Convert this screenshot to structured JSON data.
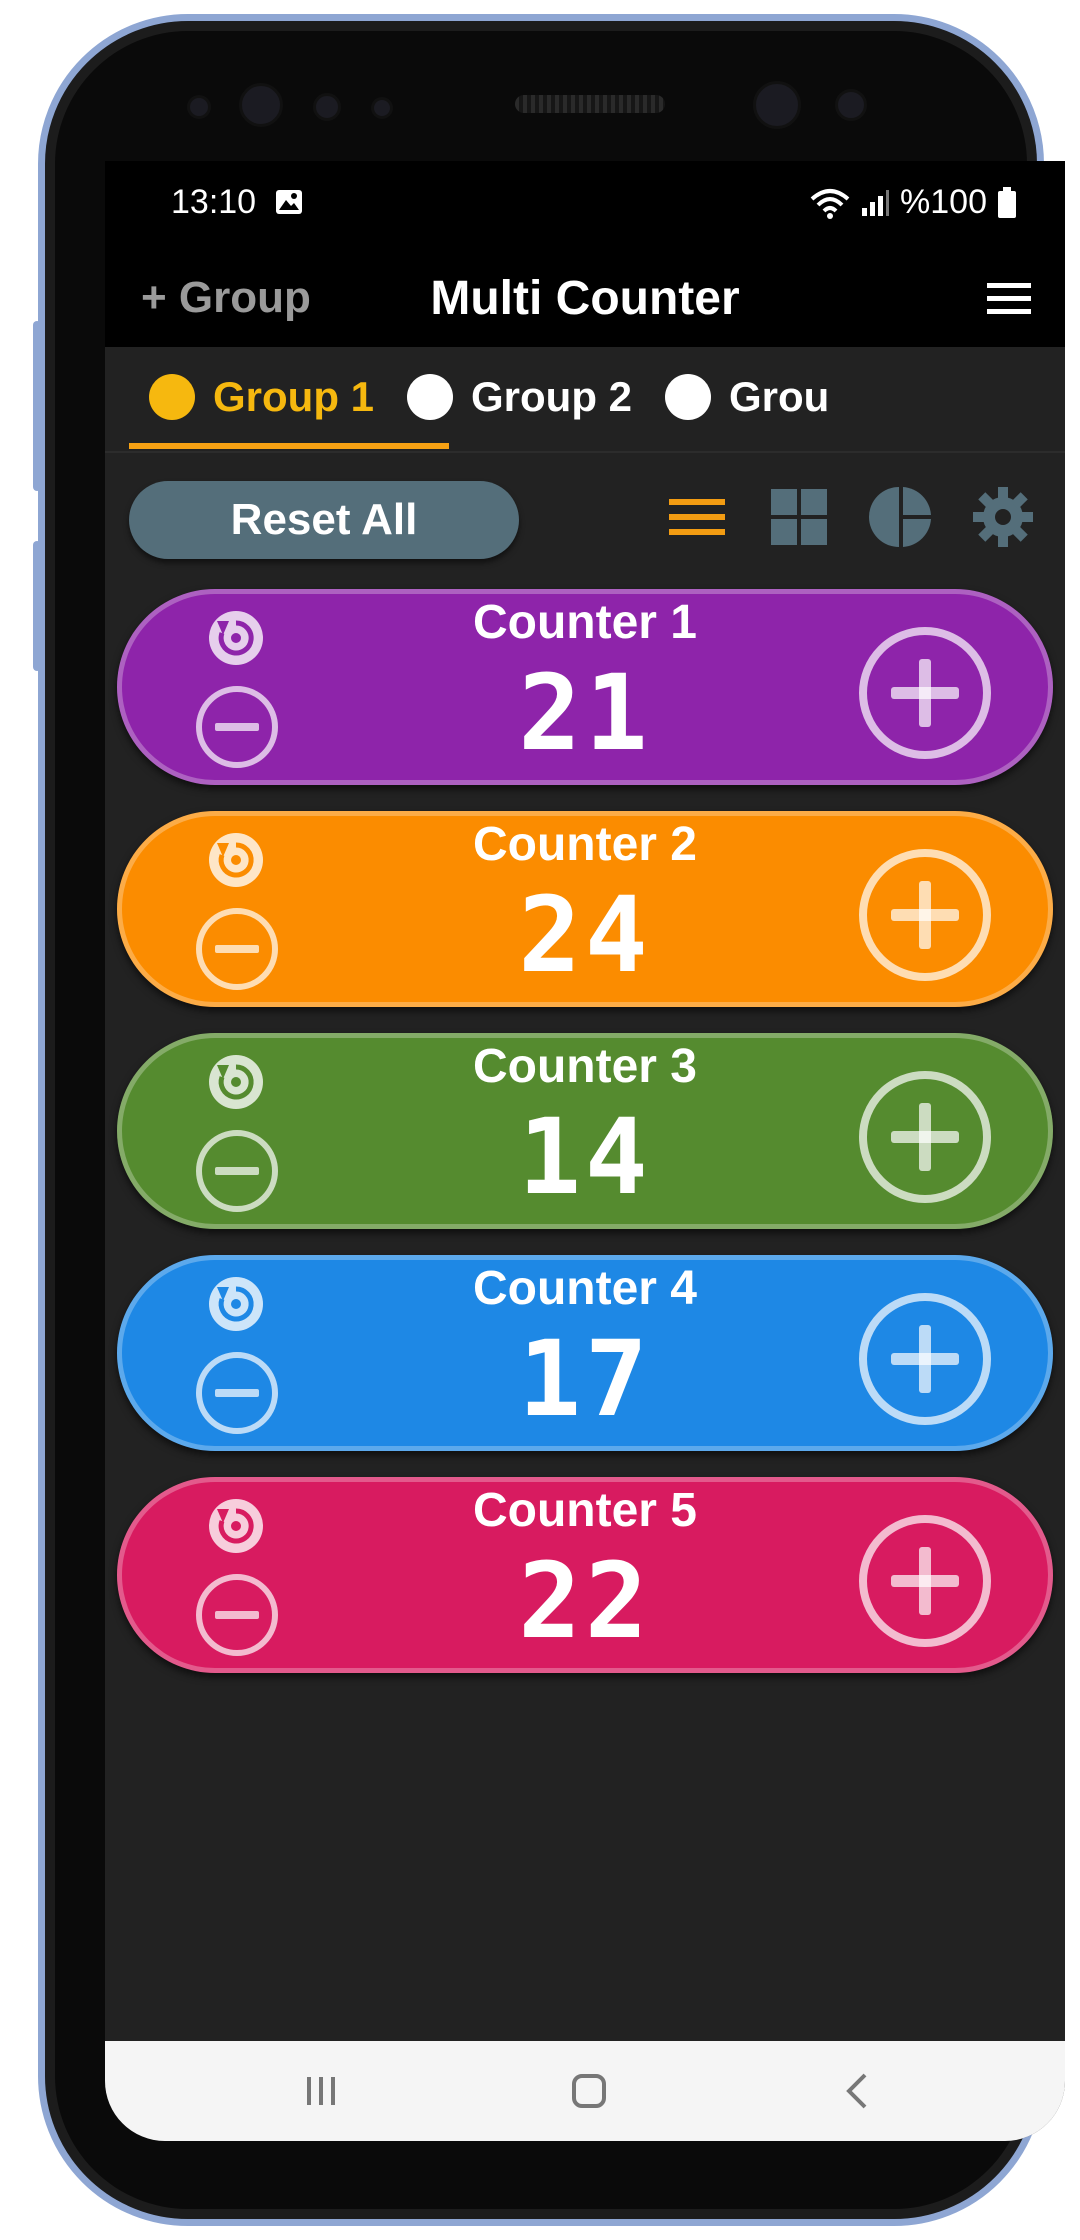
{
  "status_bar": {
    "time": "13:10",
    "battery": "%100",
    "icons": [
      "image-icon",
      "wifi-icon",
      "signal-icon",
      "battery-icon"
    ]
  },
  "app_bar": {
    "add_group_label": "+ Group",
    "title": "Multi Counter",
    "menu_icon": "hamburger-menu-icon"
  },
  "tabs": [
    {
      "label": "Group 1",
      "active": true
    },
    {
      "label": "Group 2",
      "active": false
    },
    {
      "label": "Grou",
      "active": false
    }
  ],
  "toolbar": {
    "reset_all_label": "Reset All",
    "icons": [
      "list-view-icon",
      "grid-view-icon",
      "chart-view-icon",
      "settings-icon"
    ],
    "active_icon_color": "#f39c12",
    "inactive_icon_color": "#546e7a"
  },
  "counters": [
    {
      "name": "Counter 1",
      "value": "21",
      "color": "#8e24aa"
    },
    {
      "name": "Counter 2",
      "value": "24",
      "color": "#fb8c00"
    },
    {
      "name": "Counter 3",
      "value": "14",
      "color": "#558b2f"
    },
    {
      "name": "Counter 4",
      "value": "17",
      "color": "#1e88e5"
    },
    {
      "name": "Counter 5",
      "value": "22",
      "color": "#d81b60"
    }
  ],
  "nav_bar": {
    "icons": [
      "recent-apps-icon",
      "home-icon",
      "back-icon"
    ]
  },
  "colors": {
    "accent": "#f6b80f",
    "background": "#222222",
    "reset_button": "#546e7a"
  }
}
